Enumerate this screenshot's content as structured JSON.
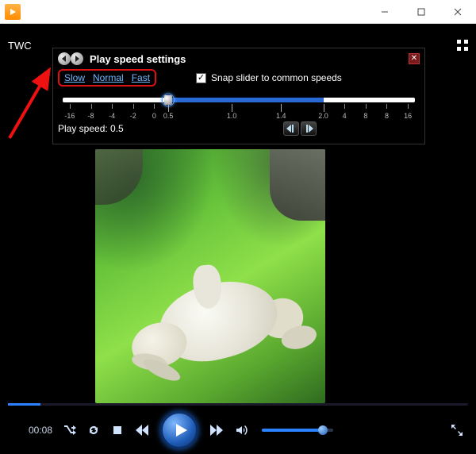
{
  "titlebar": {
    "app_name": "Windows Media Player"
  },
  "brand": "TWC",
  "speed_panel": {
    "title": "Play speed settings",
    "presets": {
      "slow": "Slow",
      "normal": "Normal",
      "fast": "Fast"
    },
    "snap_label": "Snap slider to common speeds",
    "snap_checked": true,
    "slider": {
      "value": 0.5,
      "value_pct": 30,
      "fill_start_pct": 30,
      "fill_end_pct": 74,
      "ticks": [
        {
          "pct": 2,
          "label": "-16"
        },
        {
          "pct": 8,
          "label": "-8"
        },
        {
          "pct": 14,
          "label": "-4"
        },
        {
          "pct": 20,
          "label": "-2"
        },
        {
          "pct": 26,
          "label": "0"
        },
        {
          "pct": 30,
          "label": "0.5",
          "major": true
        },
        {
          "pct": 48,
          "label": "1.0",
          "major": true
        },
        {
          "pct": 62,
          "label": "1.4",
          "major": true
        },
        {
          "pct": 74,
          "label": "2.0",
          "major": true
        },
        {
          "pct": 80,
          "label": "4"
        },
        {
          "pct": 86,
          "label": "8"
        },
        {
          "pct": 92,
          "label": "8"
        },
        {
          "pct": 98,
          "label": "16"
        }
      ]
    },
    "readout_prefix": "Play speed: ",
    "readout_value": "0.5"
  },
  "playback": {
    "elapsed": "00:08",
    "seek_pct": 7,
    "volume_pct": 85
  },
  "colors": {
    "accent": "#2a82ff",
    "annotation": "#e11"
  }
}
